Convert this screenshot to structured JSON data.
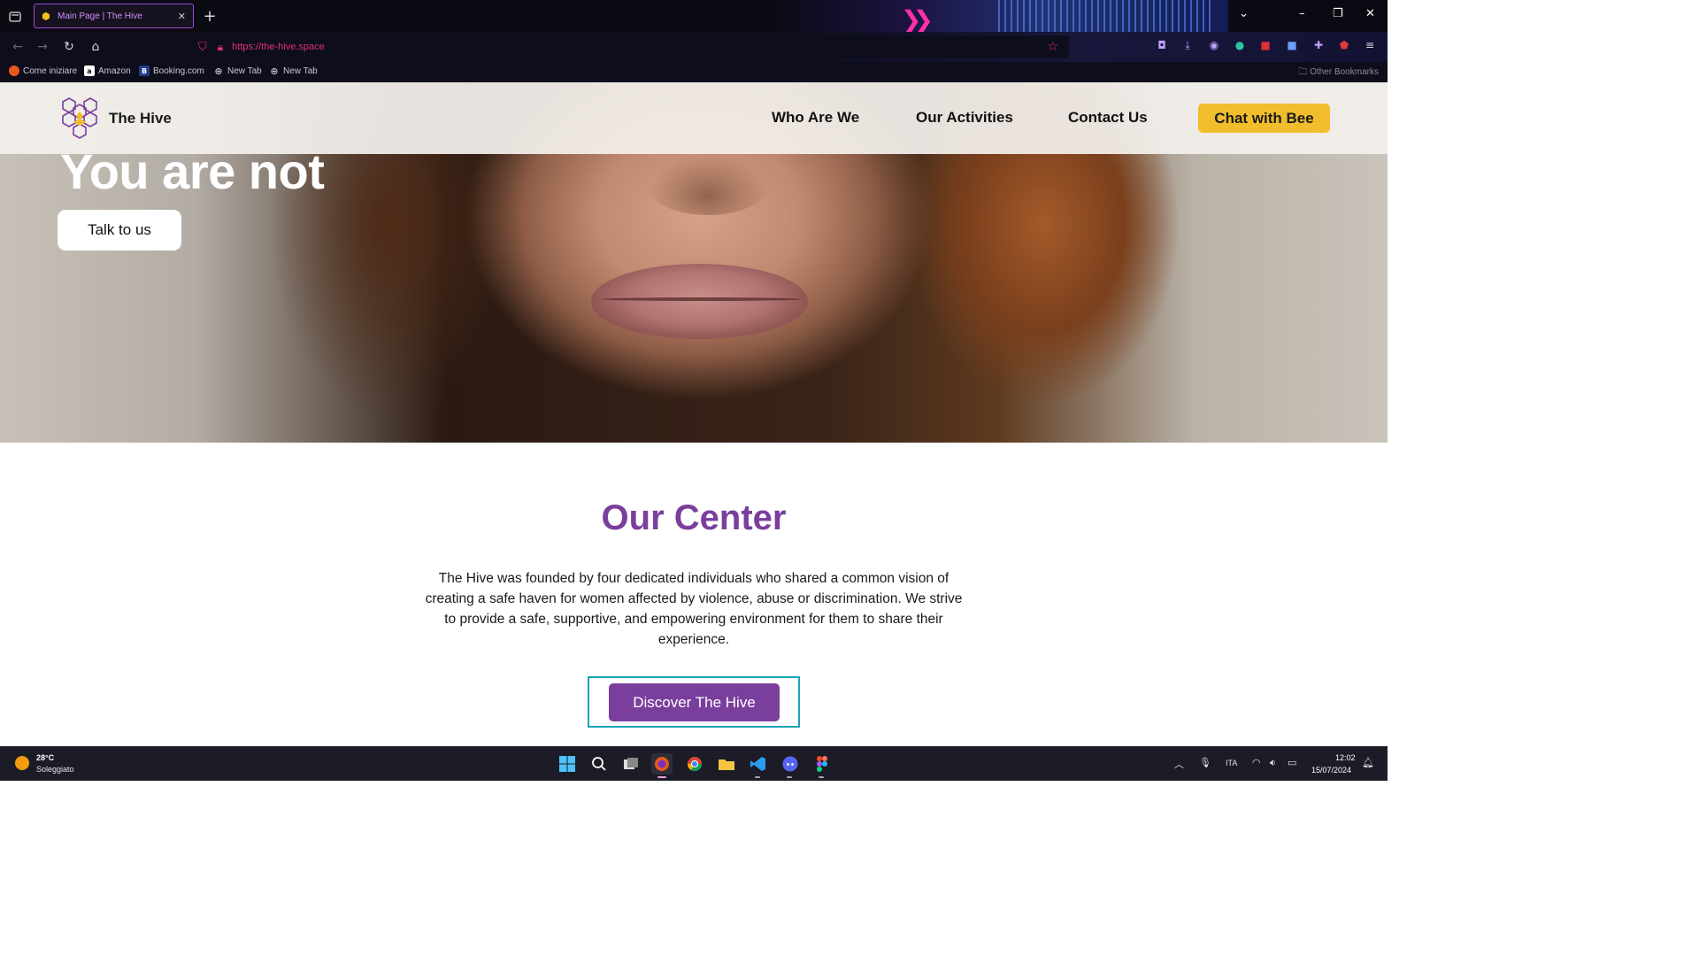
{
  "browser": {
    "tab_title": "Main Page | The Hive",
    "new_tab_symbol": "+",
    "url": "https://the-hive.space",
    "bookmarks": [
      {
        "label": "Come iniziare"
      },
      {
        "label": "Amazon"
      },
      {
        "label": "Booking.com"
      },
      {
        "label": "New Tab"
      },
      {
        "label": "New Tab"
      }
    ],
    "other_bookmarks": "Other Bookmarks"
  },
  "site": {
    "brand": "The Hive",
    "nav": {
      "who": "Who Are We",
      "activities": "Our Activities",
      "contact": "Contact Us",
      "chat": "Chat with Bee"
    },
    "hero": {
      "headline": "You are not",
      "cta": "Talk to us"
    },
    "center": {
      "title": "Our Center",
      "body": "The Hive was founded by four dedicated individuals who shared a common vision of creating a safe haven for women affected by violence, abuse or discrimination. We strive to provide a safe, supportive, and empowering environment for them to share their experience.",
      "cta": "Discover The Hive"
    },
    "colors": {
      "brand_purple": "#7a3f9d",
      "chat_yellow": "#f2bd2c",
      "focus_teal": "#1aa3b8"
    }
  },
  "taskbar": {
    "weather_temp": "28°C",
    "weather_desc": "Soleggiato",
    "language": "ITA",
    "time": "12:02",
    "date": "15/07/2024"
  }
}
